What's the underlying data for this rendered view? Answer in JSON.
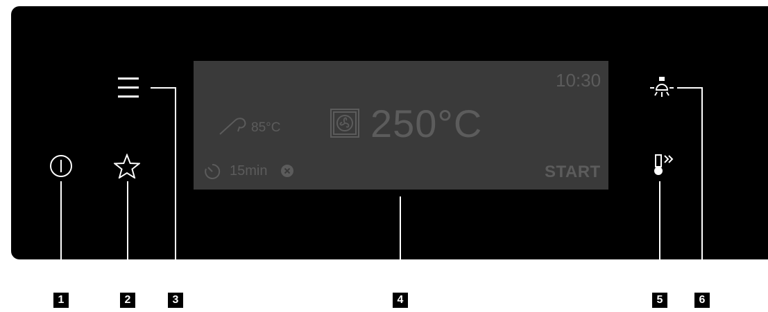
{
  "display": {
    "time": "10:30",
    "probe_temperature": "85°C",
    "oven_temperature": "250°C",
    "timer": "15min",
    "start_label": "START"
  },
  "icons": {
    "power": "power-icon",
    "favourites": "star-icon",
    "menu": "menu-icon",
    "light": "light-icon",
    "fast_heat_up": "fast-heat-up-icon",
    "probe": "meat-probe-icon",
    "heating_function": "fan-heating-icon",
    "timer": "timer-icon",
    "cancel": "cancel-icon"
  },
  "callouts": [
    "1",
    "2",
    "3",
    "4",
    "5",
    "6"
  ],
  "colors": {
    "panel": "#000000",
    "display": "#3a3a3a",
    "display_text": "#5c5c5c",
    "icons": "#ffffff"
  }
}
